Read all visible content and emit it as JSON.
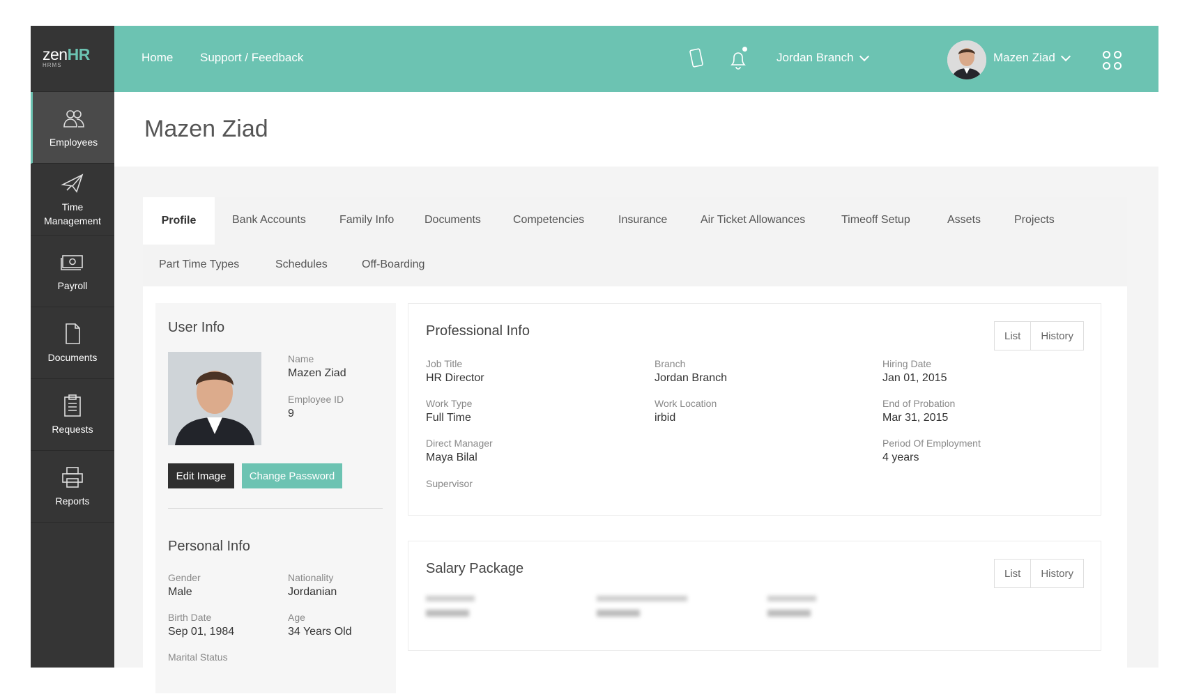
{
  "brand": {
    "main": "zen",
    "accent": "HR",
    "sub": "HRMS"
  },
  "sidebar": {
    "items": [
      {
        "label": "Employees",
        "icon": "users-icon"
      },
      {
        "label": "Time Management",
        "icon": "plane-icon"
      },
      {
        "label": "Payroll",
        "icon": "cash-icon"
      },
      {
        "label": "Documents",
        "icon": "document-icon"
      },
      {
        "label": "Requests",
        "icon": "clipboard-icon"
      },
      {
        "label": "Reports",
        "icon": "printer-icon"
      }
    ]
  },
  "topbar": {
    "home": "Home",
    "support": "Support / Feedback",
    "branch": "Jordan Branch",
    "user": "Mazen Ziad"
  },
  "page": {
    "title": "Mazen Ziad"
  },
  "tabs": [
    "Profile",
    "Bank Accounts",
    "Family Info",
    "Documents",
    "Competencies",
    "Insurance",
    "Air Ticket Allowances",
    "Timeoff Setup",
    "Assets",
    "Projects",
    "Part Time Types",
    "Schedules",
    "Off-Boarding"
  ],
  "user_info": {
    "title": "User Info",
    "name_label": "Name",
    "name": "Mazen Ziad",
    "id_label": "Employee ID",
    "id": "9",
    "edit_image": "Edit Image",
    "change_password": "Change Password"
  },
  "personal_info": {
    "title": "Personal Info",
    "gender_label": "Gender",
    "gender": "Male",
    "nationality_label": "Nationality",
    "nationality": "Jordanian",
    "birth_label": "Birth Date",
    "birth": "Sep 01, 1984",
    "age_label": "Age",
    "age": "34 Years Old",
    "marital_label": "Marital Status"
  },
  "professional_info": {
    "title": "Professional Info",
    "list": "List",
    "history": "History",
    "job_title_label": "Job Title",
    "job_title": "HR Director",
    "branch_label": "Branch",
    "branch": "Jordan Branch",
    "hiring_label": "Hiring Date",
    "hiring": "Jan 01, 2015",
    "work_type_label": "Work Type",
    "work_type": "Full Time",
    "location_label": "Work Location",
    "location": "irbid",
    "probation_label": "End of Probation",
    "probation": "Mar 31, 2015",
    "manager_label": "Direct Manager",
    "manager": "Maya Bilal",
    "period_label": "Period Of Employment",
    "period": "4 years",
    "supervisor_label": "Supervisor"
  },
  "salary": {
    "title": "Salary Package",
    "list": "List",
    "history": "History"
  },
  "colors": {
    "accent": "#6cc3b2",
    "sidebar": "#353535"
  }
}
